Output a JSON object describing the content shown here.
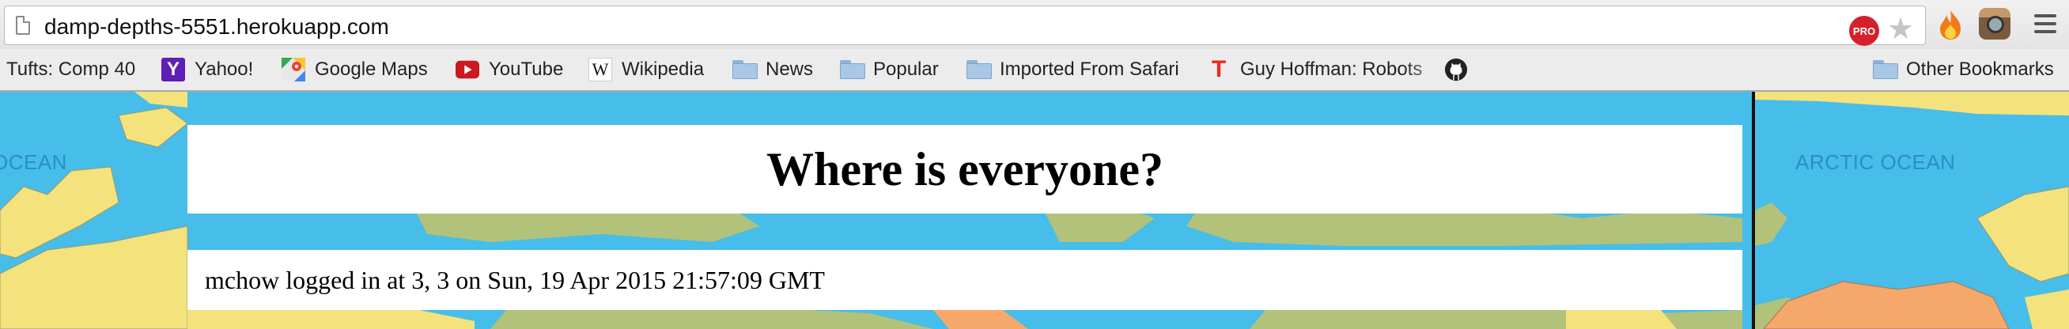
{
  "browser": {
    "url": "damp-depths-5551.herokuapp.com",
    "extensions": [
      {
        "name": "adblock-pro-icon",
        "label": "PRO"
      },
      {
        "name": "bookmark-star-icon"
      },
      {
        "name": "fire-extension-icon"
      },
      {
        "name": "instagram-extension-icon"
      }
    ]
  },
  "bookmarks": {
    "items": [
      {
        "label": "Tufts: Comp 40",
        "icon": "none"
      },
      {
        "label": "Yahoo!",
        "icon": "yahoo-icon",
        "icon_text": "Y",
        "color": "#5f1eb5"
      },
      {
        "label": "Google Maps",
        "icon": "google-maps-icon"
      },
      {
        "label": "YouTube",
        "icon": "youtube-icon",
        "color": "#cc181e"
      },
      {
        "label": "Wikipedia",
        "icon": "wikipedia-icon",
        "icon_text": "W"
      },
      {
        "label": "News",
        "icon": "folder-icon"
      },
      {
        "label": "Popular",
        "icon": "folder-icon"
      },
      {
        "label": "Imported From Safari",
        "icon": "folder-icon"
      },
      {
        "label": "Guy Hoffman: Robots",
        "icon": "ted-icon",
        "icon_text": "T",
        "color": "#e62b1e"
      },
      {
        "label": "",
        "icon": "github-icon"
      }
    ],
    "other": {
      "label": "Other Bookmarks",
      "icon": "folder-icon"
    }
  },
  "page": {
    "heading": "Where is everyone?",
    "login_message": "mchow logged in at 3, 3 on Sun, 19 Apr 2015 21:57:09 GMT",
    "map_labels": {
      "left": "OCEAN",
      "right": "ARCTIC OCEAN"
    }
  },
  "colors": {
    "ocean": "#47bde9",
    "land_green": "#b2c27a",
    "land_yellow": "#f4e27c",
    "land_orange": "#f6a86b"
  }
}
